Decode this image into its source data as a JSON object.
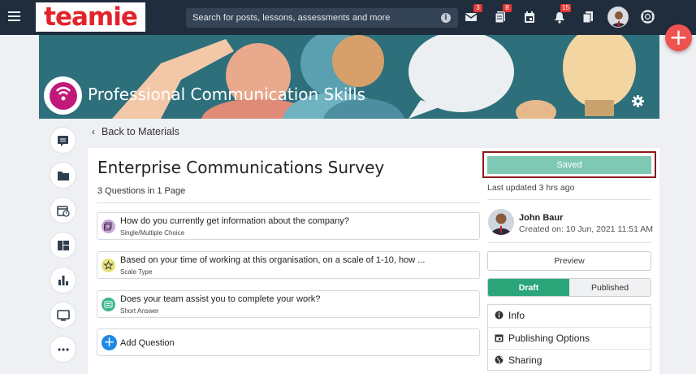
{
  "topbar": {
    "logo_text": "teamie",
    "search_placeholder": "Search for posts, lessons, assessments and more",
    "badges": {
      "messages": "3",
      "posts": "8",
      "notifications": "15"
    }
  },
  "course": {
    "title": "Professional Communication Skills"
  },
  "nav": {
    "back_label": "Back to Materials"
  },
  "survey": {
    "title": "Enterprise Communications Survey",
    "summary": "3 Questions in 1 Page",
    "questions": [
      {
        "text": "How do you currently get information about the company?",
        "type": "Single/Multiple Choice",
        "icon": "multiple-choice-icon",
        "color": "#c9a8d8"
      },
      {
        "text": "Based on your time of working at this organisation, on a scale of 1-10, how ...",
        "type": "Scale Type",
        "icon": "star-icon",
        "color": "#e6e27a"
      },
      {
        "text": "Does your team assist you to complete your work?",
        "type": "Short Answer",
        "icon": "short-answer-icon",
        "color": "#3bb98c"
      }
    ],
    "add_question_label": "Add Question"
  },
  "panel": {
    "saved_label": "Saved",
    "last_updated": "Last updated 3 hrs ago",
    "author_name": "John Baur",
    "created_on": "Created on: 10 Jun, 2021 11:51 AM",
    "preview_label": "Preview",
    "draft_label": "Draft",
    "published_label": "Published",
    "options": [
      {
        "label": "Info",
        "icon": "info-circle-icon"
      },
      {
        "label": "Publishing Options",
        "icon": "calendar-icon"
      },
      {
        "label": "Sharing",
        "icon": "globe-icon"
      }
    ]
  },
  "colors": {
    "topbar": "#1f2d3d",
    "draft_green": "#2aa67a",
    "saved_green": "#7fc9b4",
    "fab_red": "#ef5350",
    "logo_red": "#e2232a"
  }
}
